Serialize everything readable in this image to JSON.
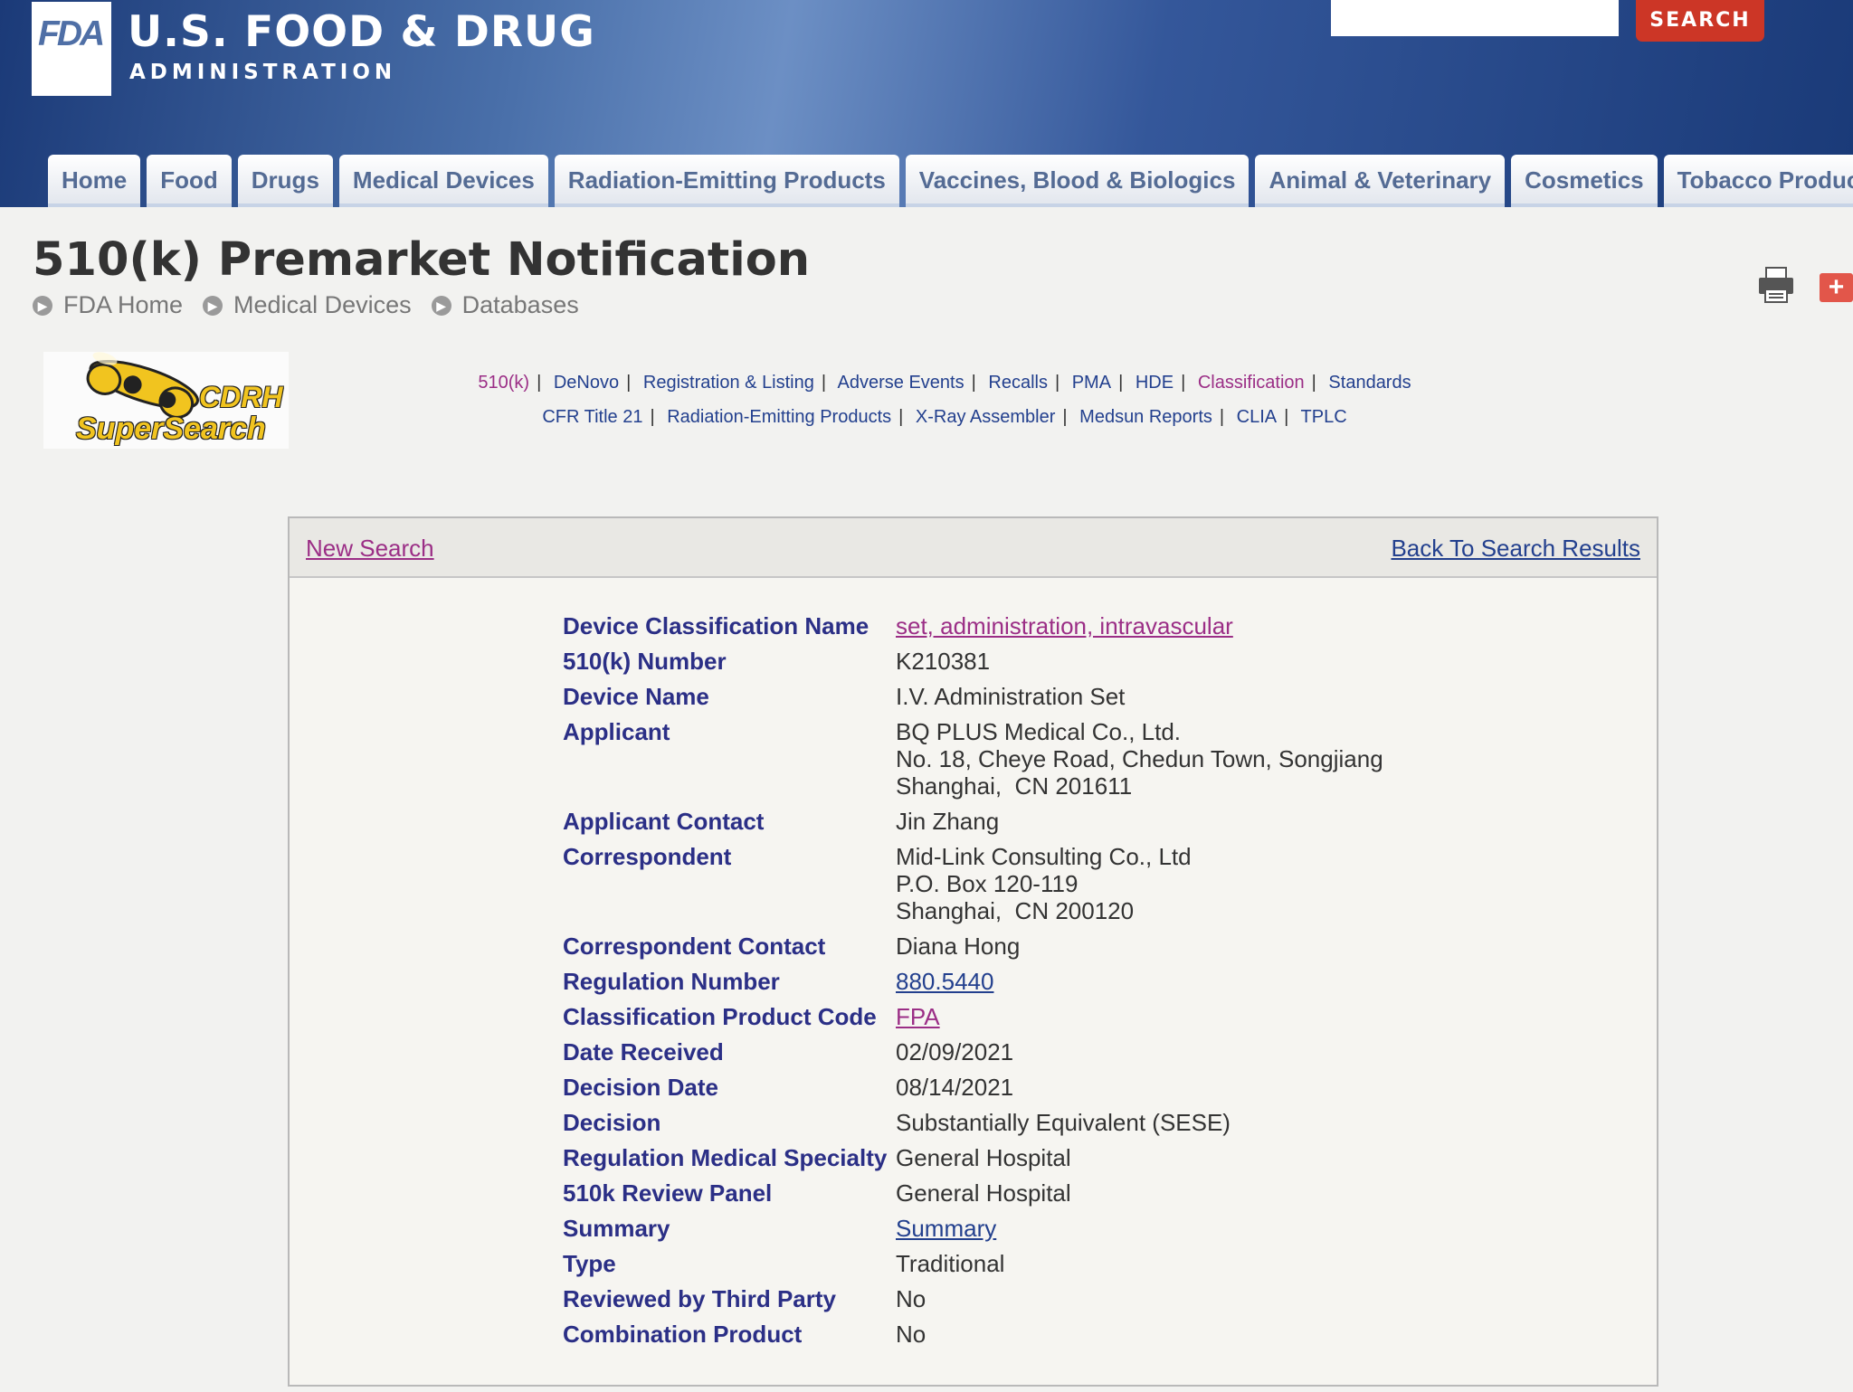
{
  "header": {
    "logo_text": "FDA",
    "agency_name": "U.S. FOOD & DRUG",
    "agency_sub": "ADMINISTRATION",
    "search_placeholder": "",
    "search_button": "SEARCH"
  },
  "nav": {
    "tabs": [
      {
        "label": "Home"
      },
      {
        "label": "Food"
      },
      {
        "label": "Drugs"
      },
      {
        "label": "Medical Devices"
      },
      {
        "label": "Radiation-Emitting Products"
      },
      {
        "label": "Vaccines, Blood & Biologics"
      },
      {
        "label": "Animal & Veterinary"
      },
      {
        "label": "Cosmetics"
      },
      {
        "label": "Tobacco Products"
      }
    ]
  },
  "page": {
    "title": "510(k) Premarket Notification",
    "breadcrumb": [
      "FDA Home",
      "Medical Devices",
      "Databases"
    ]
  },
  "cdrh_logo": {
    "line1": "CDRH",
    "line2": "SuperSearch"
  },
  "db_links": {
    "row1": [
      "510(k)",
      "DeNovo",
      "Registration & Listing",
      "Adverse Events",
      "Recalls",
      "PMA",
      "HDE",
      "Classification",
      "Standards"
    ],
    "row2": [
      "CFR Title 21",
      "Radiation-Emitting Products",
      "X-Ray Assembler",
      "Medsun Reports",
      "CLIA",
      "TPLC"
    ]
  },
  "panel": {
    "new_search": "New Search",
    "back_to_results": "Back To Search Results"
  },
  "record": {
    "device_classification_name": {
      "label": "Device Classification Name",
      "value": "set, administration, intravascular"
    },
    "k_number": {
      "label": "510(k) Number",
      "value": "K210381"
    },
    "device_name": {
      "label": "Device Name",
      "value": "I.V. Administration Set"
    },
    "applicant": {
      "label": "Applicant",
      "lines": [
        "BQ PLUS Medical Co., Ltd.",
        "No. 18, Cheye Road, Chedun Town, Songjiang",
        "Shanghai,  CN 201611"
      ]
    },
    "applicant_contact": {
      "label": "Applicant Contact",
      "value": "Jin Zhang"
    },
    "correspondent": {
      "label": "Correspondent",
      "lines": [
        "Mid-Link Consulting Co., Ltd",
        "P.O. Box 120-119",
        "Shanghai,  CN 200120"
      ]
    },
    "correspondent_contact": {
      "label": "Correspondent Contact",
      "value": "Diana Hong"
    },
    "regulation_number": {
      "label": "Regulation Number",
      "value": "880.5440"
    },
    "product_code": {
      "label": "Classification Product Code",
      "value": "FPA"
    },
    "date_received": {
      "label": "Date Received",
      "value": "02/09/2021"
    },
    "decision_date": {
      "label": "Decision Date",
      "value": "08/14/2021"
    },
    "decision": {
      "label": "Decision",
      "value": "Substantially Equivalent (SESE)"
    },
    "medical_specialty": {
      "label": "Regulation Medical Specialty",
      "value": "General Hospital"
    },
    "review_panel": {
      "label": "510k Review Panel",
      "value": "General Hospital"
    },
    "summary": {
      "label": "Summary",
      "value": "Summary"
    },
    "type": {
      "label": "Type",
      "value": "Traditional"
    },
    "third_party": {
      "label": "Reviewed by Third Party",
      "value": "No"
    },
    "combination_product": {
      "label": "Combination Product",
      "value": "No"
    }
  }
}
